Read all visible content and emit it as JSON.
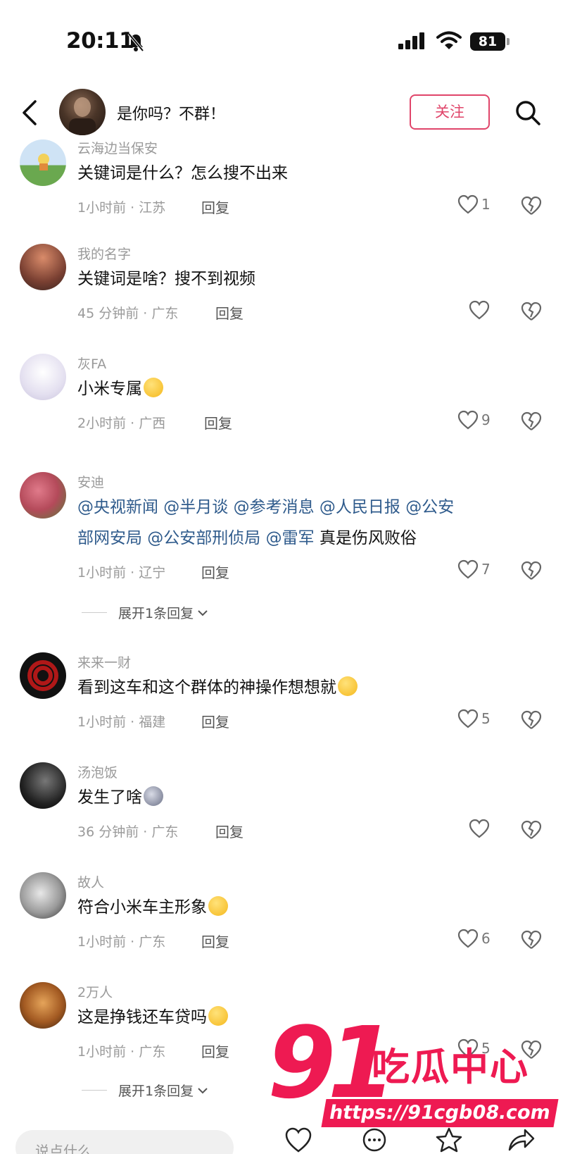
{
  "status_bar": {
    "time": "20:11",
    "battery": "81"
  },
  "header": {
    "title": "是你吗？不群！",
    "follow_label": "关注"
  },
  "comments": [
    {
      "username": "云海边当保安",
      "text": "关键词是什么？怎么搜不出来",
      "meta": "1小时前 · 江苏",
      "reply": "回复",
      "likes": "1"
    },
    {
      "username": "我的名字",
      "text": "关键词是啥？搜不到视频",
      "meta": "45 分钟前 · 广东",
      "reply": "回复",
      "likes": ""
    },
    {
      "username": "灰FA",
      "text": "小米专属",
      "meta": "2小时前 · 广西",
      "reply": "回复",
      "likes": "9"
    },
    {
      "username": "安迪",
      "mentions_line1": "@央视新闻 @半月谈 @参考消息 @人民日报 @公安",
      "mentions_line2": "部网安局 @公安部刑侦局 @雷军",
      "text": "真是伤风败俗",
      "meta": "1小时前 · 辽宁",
      "reply": "回复",
      "likes": "7",
      "expand": "展开1条回复"
    },
    {
      "username": "来来一财",
      "text": "看到这车和这个群体的神操作想想就",
      "meta": "1小时前 · 福建",
      "reply": "回复",
      "likes": "5"
    },
    {
      "username": "汤泡饭",
      "text": "发生了啥",
      "meta": "36 分钟前 · 广东",
      "reply": "回复",
      "likes": ""
    },
    {
      "username": "故人",
      "text": "符合小米车主形象",
      "meta": "1小时前 · 广东",
      "reply": "回复",
      "likes": "6"
    },
    {
      "username": "2万人",
      "text": "这是挣钱还车贷吗",
      "meta": "1小时前 · 广东",
      "reply": "回复",
      "likes": "5",
      "expand": "展开1条回复"
    }
  ],
  "bottom_bar": {
    "placeholder": "说点什么"
  },
  "watermark": {
    "big": "91",
    "name": "吃瓜中心",
    "url": "https://91cgb08.com"
  },
  "colors": {
    "accent": "#e0456a",
    "mention": "#2f5b8c",
    "watermark": "#ee1a52"
  }
}
